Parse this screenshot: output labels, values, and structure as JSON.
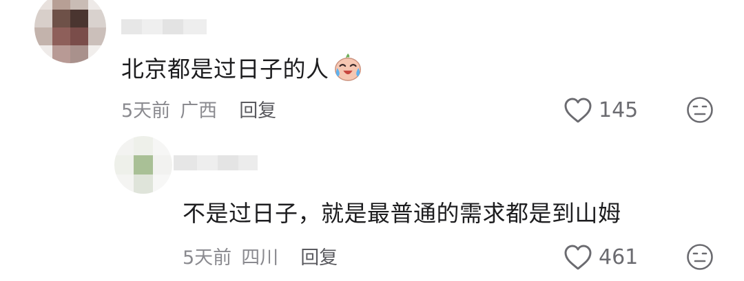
{
  "colors": {
    "text": "#1d1d1f",
    "meta": "#8a8a8f",
    "icon": "#6b6b70"
  },
  "comments": [
    {
      "text": "北京都是过日子的人",
      "emoji_icon": "crying-laughing-face-icon",
      "time": "5天前",
      "location": "广西",
      "reply_label": "回复",
      "likes": "145",
      "like_icon": "heart-outline-icon",
      "dislike_icon": "neutral-face-icon"
    },
    {
      "text": "不是过日子，就是最普通的需求都是到山姆",
      "time": "5天前",
      "location": "四川",
      "reply_label": "回复",
      "likes": "461",
      "like_icon": "heart-outline-icon",
      "dislike_icon": "neutral-face-icon"
    }
  ]
}
